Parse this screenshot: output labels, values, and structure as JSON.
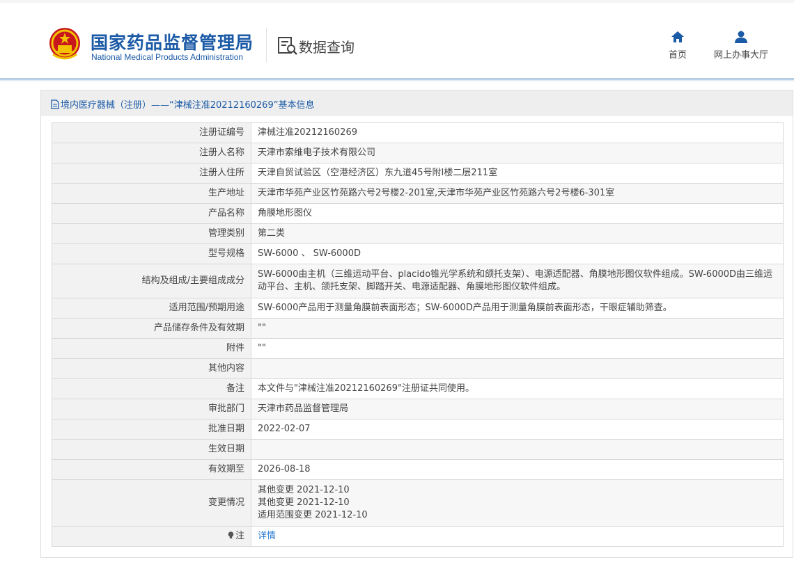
{
  "header": {
    "org_name_cn": "国家药品监督管理局",
    "org_name_en": "National Medical Products Administration",
    "section_title": "数据查询",
    "nav": [
      {
        "label": "首页",
        "icon": "home-icon"
      },
      {
        "label": "网上办事大厅",
        "icon": "user-icon"
      }
    ]
  },
  "panel": {
    "title": "境内医疗器械（注册）——“津械注准20212160269”基本信息"
  },
  "rows": [
    {
      "label": "注册证编号",
      "value": "津械注准20212160269"
    },
    {
      "label": "注册人名称",
      "value": "天津市索维电子技术有限公司"
    },
    {
      "label": "注册人住所",
      "value": "天津自贸试验区（空港经济区）东九道45号附I楼二层211室"
    },
    {
      "label": "生产地址",
      "value": "天津市华苑产业区竹苑路六号2号楼2-201室,天津市华苑产业区竹苑路六号2号楼6-301室"
    },
    {
      "label": "产品名称",
      "value": "角膜地形图仪"
    },
    {
      "label": "管理类别",
      "value": "第二类"
    },
    {
      "label": "型号规格",
      "value": "SW-6000 、 SW-6000D"
    },
    {
      "label": "结构及组成/主要组成成分",
      "value": "SW-6000由主机（三维运动平台、placido锥光学系统和颌托支架）、电源适配器、角膜地形图仪软件组成。SW-6000D由三维运动平台、主机、颌托支架、脚踏开关、电源适配器、角膜地形图仪软件组成。"
    },
    {
      "label": "适用范围/预期用途",
      "value": "SW-6000产品用于测量角膜前表面形态；SW-6000D产品用于测量角膜前表面形态，干眼症辅助筛查。"
    },
    {
      "label": "产品储存条件及有效期",
      "value": "\"\""
    },
    {
      "label": "附件",
      "value": "\"\""
    },
    {
      "label": "其他内容",
      "value": ""
    },
    {
      "label": "备注",
      "value": "本文件与\"津械注准20212160269\"注册证共同使用。"
    },
    {
      "label": "审批部门",
      "value": "天津市药品监督管理局"
    },
    {
      "label": "批准日期",
      "value": "2022-02-07"
    },
    {
      "label": "生效日期",
      "value": ""
    },
    {
      "label": "有效期至",
      "value": "2026-08-18"
    }
  ],
  "changes": {
    "label": "变更情况",
    "items": [
      "其他变更 2021-12-10",
      "其他变更 2021-12-10",
      "适用范围变更 2021-12-10"
    ]
  },
  "note": {
    "label": "注",
    "icon": "bulb-icon",
    "link_label": "详情"
  },
  "colors": {
    "brand_blue": "#1b5aa6",
    "link_blue": "#2a7ad2",
    "label_bg": "#f2f2f2",
    "border": "#d9d9d9"
  }
}
